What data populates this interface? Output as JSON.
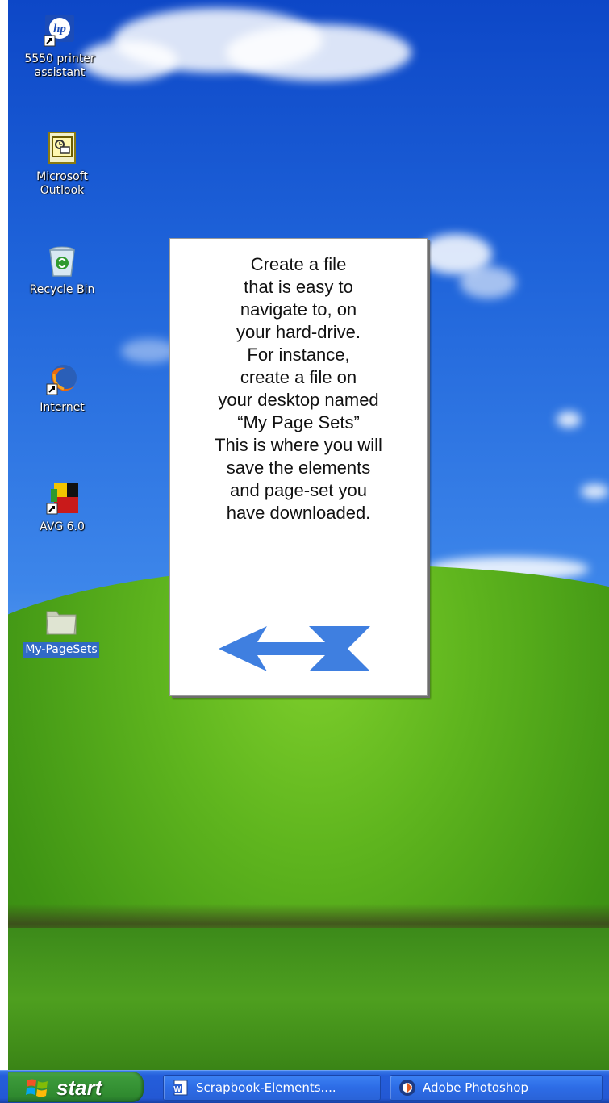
{
  "desktop": {
    "icons": [
      {
        "label": "5550 printer\nassistant",
        "icon": "hp-printer-icon"
      },
      {
        "label": "Microsoft\nOutlook",
        "icon": "outlook-icon"
      },
      {
        "label": "Recycle Bin",
        "icon": "recycle-bin-icon"
      },
      {
        "label": "Internet",
        "icon": "firefox-icon"
      },
      {
        "label": "AVG 6.0",
        "icon": "avg-icon"
      },
      {
        "label": "My-PageSets",
        "icon": "folder-icon",
        "selected": true
      }
    ]
  },
  "callout": {
    "text": "Create a file\nthat is easy to\nnavigate to, on\nyour hard-drive.\nFor instance,\ncreate a file on\nyour desktop named\n“My Page Sets”\nThis is where you will\nsave the elements\nand page-set you\nhave downloaded.",
    "arrow": "left-arrow-icon",
    "arrow_color": "#3f7fe0"
  },
  "taskbar": {
    "start_label": "start",
    "tasks": [
      {
        "label": "Scrapbook-Elements....",
        "icon": "word-doc-icon"
      },
      {
        "label": "Adobe Photoshop",
        "icon": "photoshop-icon"
      }
    ]
  }
}
